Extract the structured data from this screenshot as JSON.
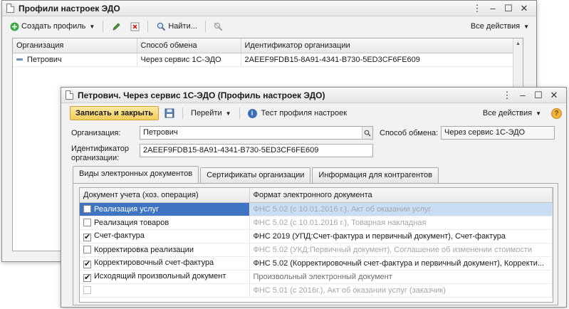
{
  "bg_window": {
    "title": "Профили настроек ЭДО",
    "toolbar": {
      "create_label": "Создать профиль",
      "find_label": "Найти...",
      "all_actions_label": "Все действия"
    },
    "grid": {
      "columns": [
        "Организация",
        "Способ обмена",
        "Идентификатор организации"
      ],
      "rows": [
        [
          "Петрович",
          "Через сервис 1С-ЭДО",
          "2AEEF9FDB15-8A91-4341-B730-5ED3CF6FE609"
        ]
      ]
    }
  },
  "fg_window": {
    "title": "Петрович. Через сервис 1С-ЭДО (Профиль настроек ЭДО)",
    "toolbar": {
      "save_close_label": "Записать и закрыть",
      "goto_label": "Перейти",
      "test_label": "Тест профиля настроек",
      "all_actions_label": "Все действия"
    },
    "form": {
      "org_label": "Организация:",
      "org_value": "Петрович",
      "exchange_label": "Способ обмена:",
      "exchange_value": "Через сервис 1С-ЭДО",
      "id_label_line1": "Идентификатор",
      "id_label_line2": "организации:",
      "id_value": "2AEEF9FDB15-8A91-4341-B730-5ED3CF6FE609"
    },
    "tabs": [
      "Виды электронных документов",
      "Сертификаты организации",
      "Информация для контрагентов"
    ],
    "doc_grid": {
      "columns": [
        "Документ учета (хоз. операция)",
        "Формат электронного документа"
      ],
      "rows": [
        {
          "checked": false,
          "doc": "Реализация услуг",
          "format": "ФНС 5.02 (с 10.01.2016 г.), Акт об оказании услуг",
          "muted": true,
          "selected": true
        },
        {
          "checked": false,
          "doc": "Реализация товаров",
          "format": "ФНС 5.02 (с 10.01.2016 г.), Товарная накладная",
          "muted": true,
          "selected": false
        },
        {
          "checked": true,
          "doc": "Счет-фактура",
          "format": "ФНС 2019 (УПД:Счет-фактура и первичный документ), Счет-фактура",
          "muted": false,
          "selected": false
        },
        {
          "checked": false,
          "doc": "Корректировка реализации",
          "format": "ФНС 5.02 (УКД:Первичный документ), Соглашение об изменении стоимости",
          "muted": true,
          "selected": false
        },
        {
          "checked": true,
          "doc": "Корректировочный счет-фактура",
          "format": "ФНС 5.02 (Корректировочный счет-фактура и первичный документ), Корректи...",
          "muted": false,
          "selected": false
        },
        {
          "checked": true,
          "doc": "Исходящий произвольный документ",
          "format": "Произвольный электронный документ",
          "muted": false,
          "selected": false,
          "format_muted_dark": true
        },
        {
          "checked": false,
          "doc": "",
          "format": "ФНС 5.01 (с 2016г.), Акт об оказании услуг (заказчик)",
          "muted": true,
          "selected": false,
          "disabled": true
        }
      ]
    }
  }
}
